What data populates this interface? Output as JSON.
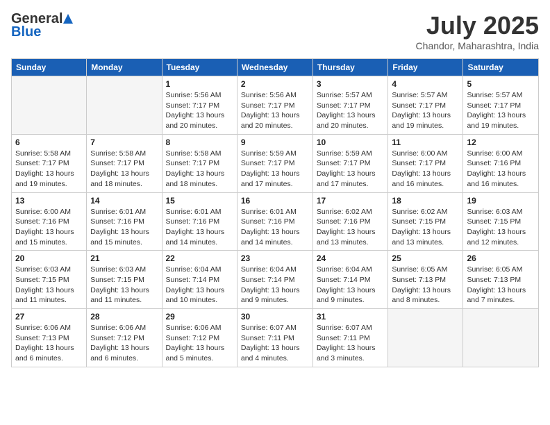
{
  "header": {
    "logo_general": "General",
    "logo_blue": "Blue",
    "month_title": "July 2025",
    "location": "Chandor, Maharashtra, India"
  },
  "days_of_week": [
    "Sunday",
    "Monday",
    "Tuesday",
    "Wednesday",
    "Thursday",
    "Friday",
    "Saturday"
  ],
  "weeks": [
    [
      {
        "day": "",
        "content": ""
      },
      {
        "day": "",
        "content": ""
      },
      {
        "day": "1",
        "content": "Sunrise: 5:56 AM\nSunset: 7:17 PM\nDaylight: 13 hours and 20 minutes."
      },
      {
        "day": "2",
        "content": "Sunrise: 5:56 AM\nSunset: 7:17 PM\nDaylight: 13 hours and 20 minutes."
      },
      {
        "day": "3",
        "content": "Sunrise: 5:57 AM\nSunset: 7:17 PM\nDaylight: 13 hours and 20 minutes."
      },
      {
        "day": "4",
        "content": "Sunrise: 5:57 AM\nSunset: 7:17 PM\nDaylight: 13 hours and 19 minutes."
      },
      {
        "day": "5",
        "content": "Sunrise: 5:57 AM\nSunset: 7:17 PM\nDaylight: 13 hours and 19 minutes."
      }
    ],
    [
      {
        "day": "6",
        "content": "Sunrise: 5:58 AM\nSunset: 7:17 PM\nDaylight: 13 hours and 19 minutes."
      },
      {
        "day": "7",
        "content": "Sunrise: 5:58 AM\nSunset: 7:17 PM\nDaylight: 13 hours and 18 minutes."
      },
      {
        "day": "8",
        "content": "Sunrise: 5:58 AM\nSunset: 7:17 PM\nDaylight: 13 hours and 18 minutes."
      },
      {
        "day": "9",
        "content": "Sunrise: 5:59 AM\nSunset: 7:17 PM\nDaylight: 13 hours and 17 minutes."
      },
      {
        "day": "10",
        "content": "Sunrise: 5:59 AM\nSunset: 7:17 PM\nDaylight: 13 hours and 17 minutes."
      },
      {
        "day": "11",
        "content": "Sunrise: 6:00 AM\nSunset: 7:17 PM\nDaylight: 13 hours and 16 minutes."
      },
      {
        "day": "12",
        "content": "Sunrise: 6:00 AM\nSunset: 7:16 PM\nDaylight: 13 hours and 16 minutes."
      }
    ],
    [
      {
        "day": "13",
        "content": "Sunrise: 6:00 AM\nSunset: 7:16 PM\nDaylight: 13 hours and 15 minutes."
      },
      {
        "day": "14",
        "content": "Sunrise: 6:01 AM\nSunset: 7:16 PM\nDaylight: 13 hours and 15 minutes."
      },
      {
        "day": "15",
        "content": "Sunrise: 6:01 AM\nSunset: 7:16 PM\nDaylight: 13 hours and 14 minutes."
      },
      {
        "day": "16",
        "content": "Sunrise: 6:01 AM\nSunset: 7:16 PM\nDaylight: 13 hours and 14 minutes."
      },
      {
        "day": "17",
        "content": "Sunrise: 6:02 AM\nSunset: 7:16 PM\nDaylight: 13 hours and 13 minutes."
      },
      {
        "day": "18",
        "content": "Sunrise: 6:02 AM\nSunset: 7:15 PM\nDaylight: 13 hours and 13 minutes."
      },
      {
        "day": "19",
        "content": "Sunrise: 6:03 AM\nSunset: 7:15 PM\nDaylight: 13 hours and 12 minutes."
      }
    ],
    [
      {
        "day": "20",
        "content": "Sunrise: 6:03 AM\nSunset: 7:15 PM\nDaylight: 13 hours and 11 minutes."
      },
      {
        "day": "21",
        "content": "Sunrise: 6:03 AM\nSunset: 7:15 PM\nDaylight: 13 hours and 11 minutes."
      },
      {
        "day": "22",
        "content": "Sunrise: 6:04 AM\nSunset: 7:14 PM\nDaylight: 13 hours and 10 minutes."
      },
      {
        "day": "23",
        "content": "Sunrise: 6:04 AM\nSunset: 7:14 PM\nDaylight: 13 hours and 9 minutes."
      },
      {
        "day": "24",
        "content": "Sunrise: 6:04 AM\nSunset: 7:14 PM\nDaylight: 13 hours and 9 minutes."
      },
      {
        "day": "25",
        "content": "Sunrise: 6:05 AM\nSunset: 7:13 PM\nDaylight: 13 hours and 8 minutes."
      },
      {
        "day": "26",
        "content": "Sunrise: 6:05 AM\nSunset: 7:13 PM\nDaylight: 13 hours and 7 minutes."
      }
    ],
    [
      {
        "day": "27",
        "content": "Sunrise: 6:06 AM\nSunset: 7:13 PM\nDaylight: 13 hours and 6 minutes."
      },
      {
        "day": "28",
        "content": "Sunrise: 6:06 AM\nSunset: 7:12 PM\nDaylight: 13 hours and 6 minutes."
      },
      {
        "day": "29",
        "content": "Sunrise: 6:06 AM\nSunset: 7:12 PM\nDaylight: 13 hours and 5 minutes."
      },
      {
        "day": "30",
        "content": "Sunrise: 6:07 AM\nSunset: 7:11 PM\nDaylight: 13 hours and 4 minutes."
      },
      {
        "day": "31",
        "content": "Sunrise: 6:07 AM\nSunset: 7:11 PM\nDaylight: 13 hours and 3 minutes."
      },
      {
        "day": "",
        "content": ""
      },
      {
        "day": "",
        "content": ""
      }
    ]
  ]
}
